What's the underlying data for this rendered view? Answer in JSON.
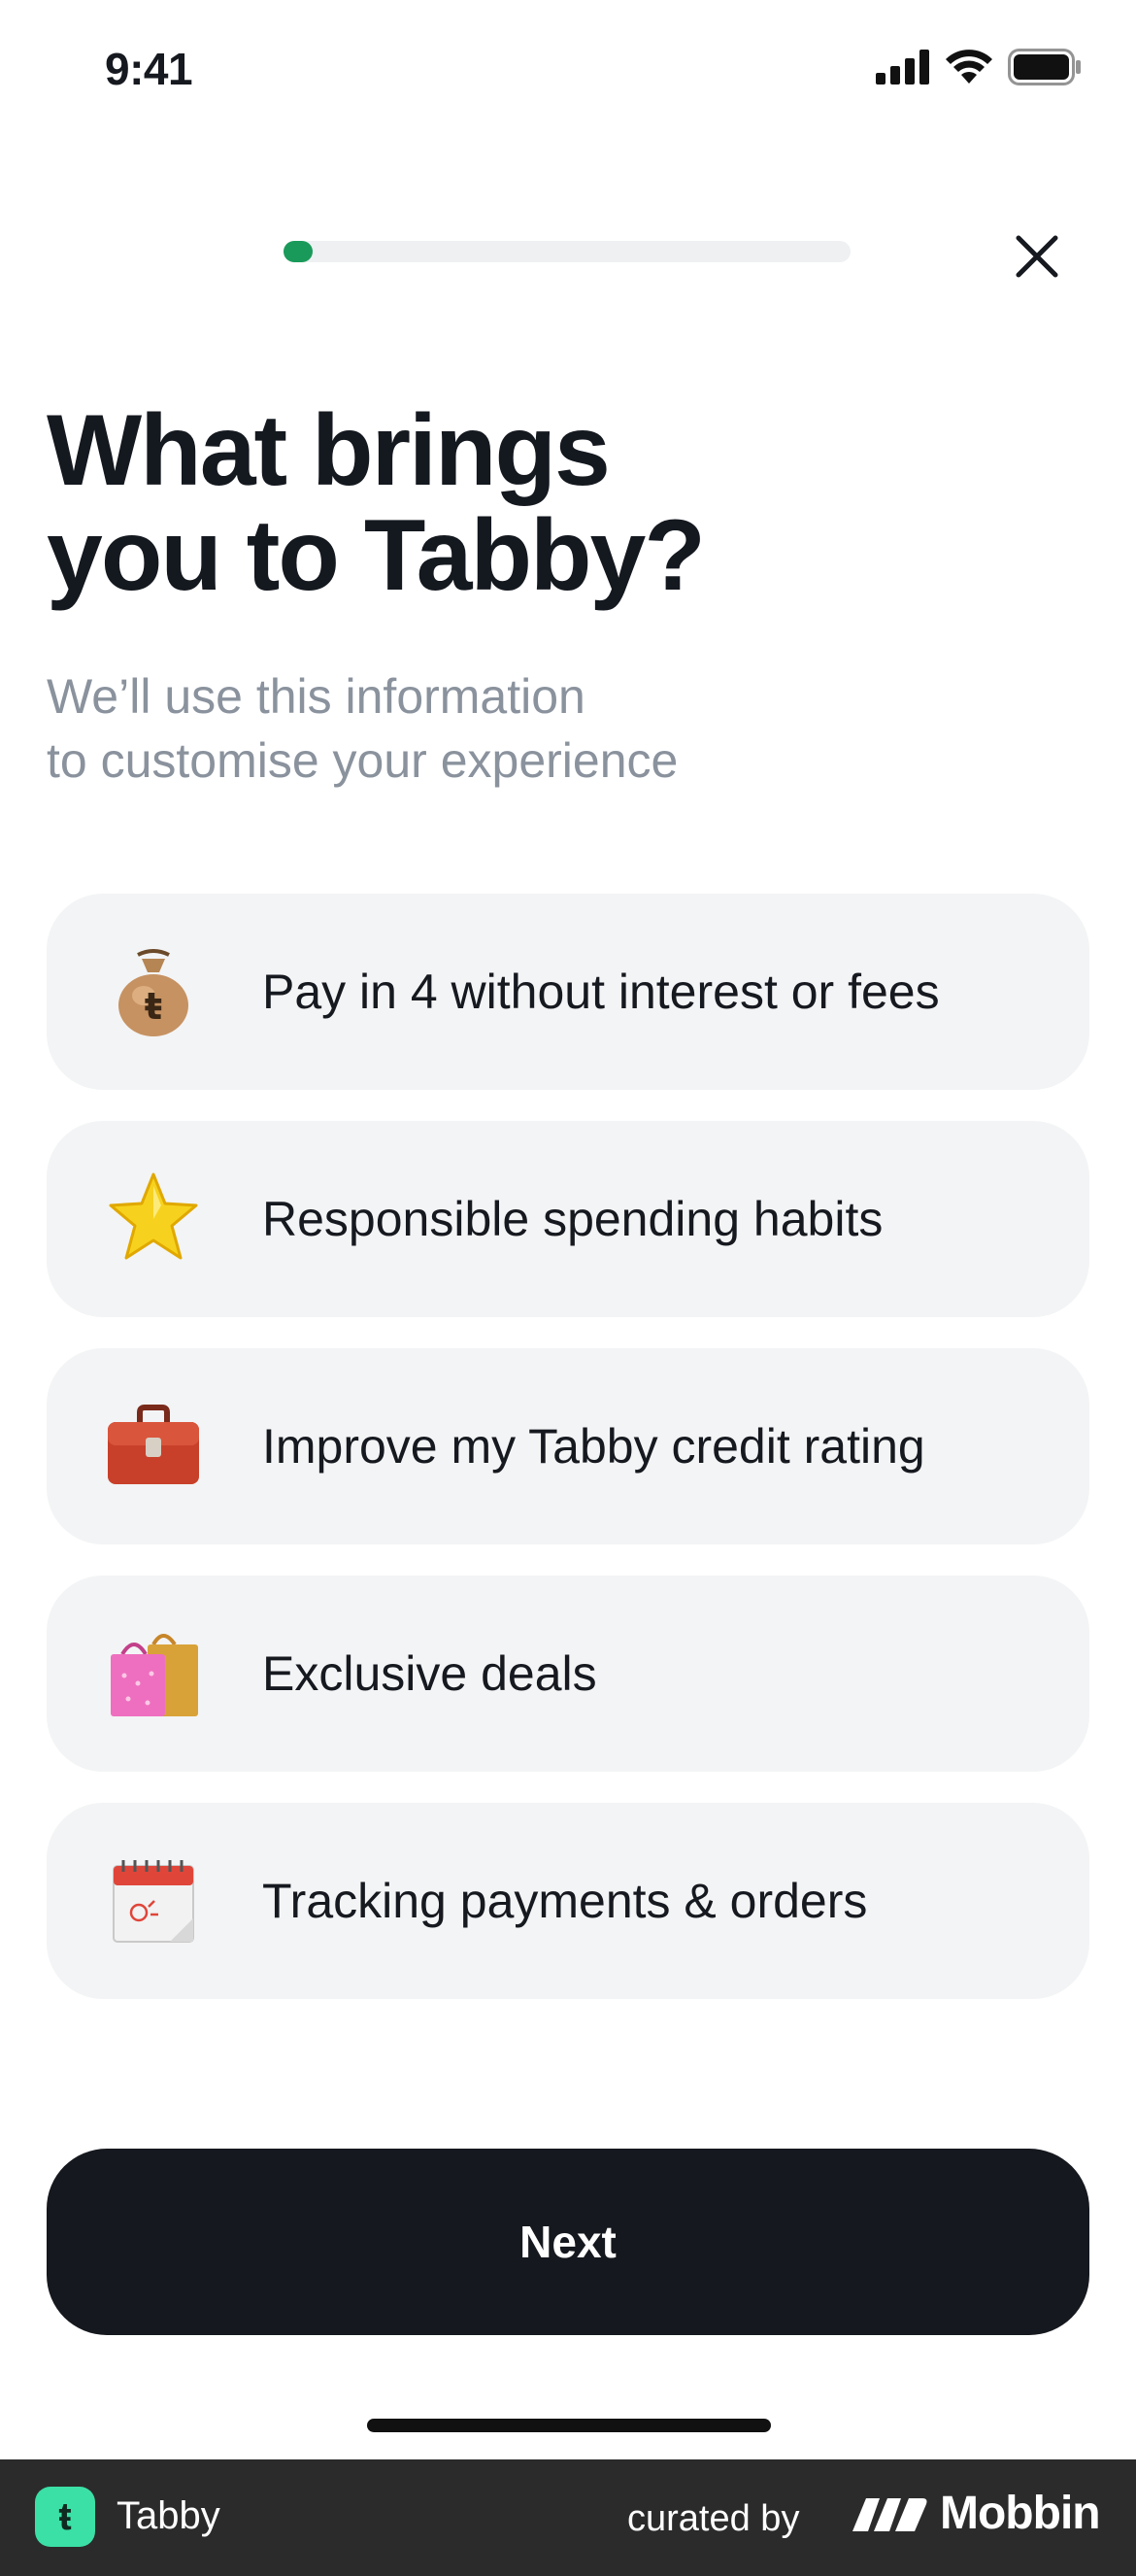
{
  "status_bar": {
    "time": "9:41"
  },
  "progress": {
    "value": 0.03
  },
  "heading": {
    "title": "What brings\nyou to Tabby?",
    "subtitle": "We’ll use this information\nto customise your experience"
  },
  "options": [
    {
      "icon": "money-bag-icon",
      "label": "Pay in 4 without interest or fees"
    },
    {
      "icon": "star-icon",
      "label": "Responsible spending habits"
    },
    {
      "icon": "briefcase-icon",
      "label": "Improve my Tabby credit rating"
    },
    {
      "icon": "shopping-bags-icon",
      "label": "Exclusive deals"
    },
    {
      "icon": "calendar-icon",
      "label": "Tracking payments & orders"
    }
  ],
  "actions": {
    "next_label": "Next"
  },
  "footer": {
    "app_logo_letter": "ŧ",
    "app_name": "Tabby",
    "curated_by": "curated by",
    "brand": "Mobbin"
  },
  "colors": {
    "accent": "#1a9a5a",
    "button_bg": "#15181e",
    "card_bg": "#f3f4f5",
    "footer_bg": "#2b2b2b",
    "logo_bg": "#3be0a6"
  }
}
